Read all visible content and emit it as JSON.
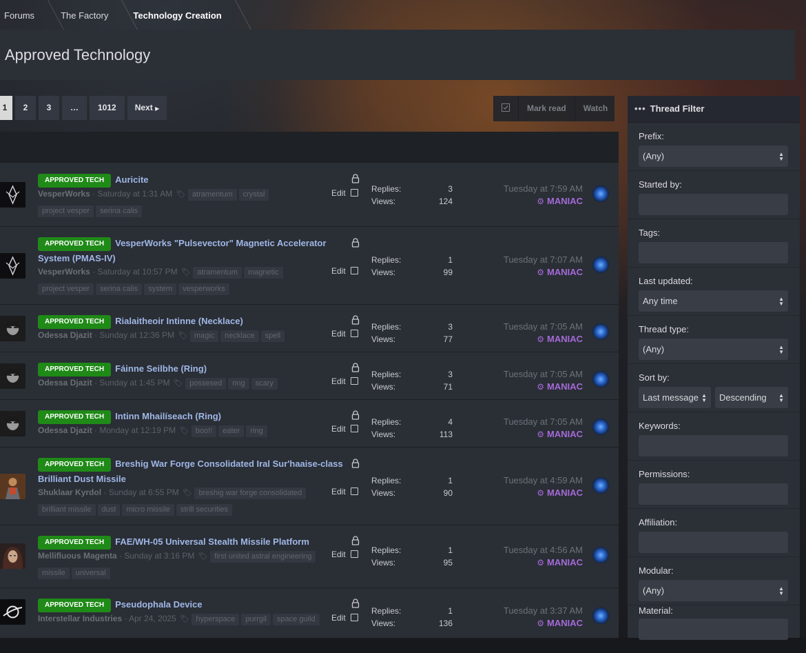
{
  "breadcrumb": [
    "Forums",
    "The Factory",
    "Technology Creation"
  ],
  "page_title": "Approved Technology",
  "pagination": {
    "pages": [
      "1",
      "2",
      "3",
      "…",
      "1012"
    ],
    "current": "1",
    "next": "Next"
  },
  "toolbar": {
    "mark_read": "Mark read",
    "watch": "Watch"
  },
  "threads": [
    {
      "prefix": "APPROVED TECH",
      "title": "Auricite",
      "author": "VesperWorks",
      "date": "Saturday at 1:31 AM",
      "tags1": [
        "atramentum",
        "crystal"
      ],
      "tags2": [
        "project vesper",
        "serina calis"
      ],
      "edit": "Edit",
      "replies_label": "Replies:",
      "views_label": "Views:",
      "replies": "3",
      "views": "124",
      "last_time": "Tuesday at 7:59 AM",
      "last_user": "MANIAC"
    },
    {
      "prefix": "APPROVED TECH",
      "title": "VesperWorks \"Pulsevector\" Magnetic Accelerator System (PMAS-IV)",
      "author": "VesperWorks",
      "date": "Saturday at 10:57 PM",
      "tags1": [
        "atramentum",
        "magnetic"
      ],
      "tags2": [
        "project vesper",
        "serina calis",
        "system",
        "vesperworks"
      ],
      "edit": "Edit",
      "replies_label": "Replies:",
      "views_label": "Views:",
      "replies": "1",
      "views": "99",
      "last_time": "Tuesday at 7:07 AM",
      "last_user": "MANIAC"
    },
    {
      "prefix": "APPROVED TECH",
      "title": "Rialaitheoir Intinne (Necklace)",
      "author": "Odessa Djazit",
      "date": "Sunday at 12:36 PM",
      "tags1": [
        "magic",
        "necklace",
        "spell"
      ],
      "tags2": [],
      "edit": "Edit",
      "replies_label": "Replies:",
      "views_label": "Views:",
      "replies": "3",
      "views": "77",
      "last_time": "Tuesday at 7:05 AM",
      "last_user": "MANIAC"
    },
    {
      "prefix": "APPROVED TECH",
      "title": "Fáinne Seilbhe (Ring)",
      "author": "Odessa Djazit",
      "date": "Sunday at 1:45 PM",
      "tags1": [
        "possesed",
        "ring",
        "scary"
      ],
      "tags2": [],
      "edit": "Edit",
      "replies_label": "Replies:",
      "views_label": "Views:",
      "replies": "3",
      "views": "71",
      "last_time": "Tuesday at 7:05 AM",
      "last_user": "MANIAC"
    },
    {
      "prefix": "APPROVED TECH",
      "title": "Intinn Mhailíseach (Ring)",
      "author": "Odessa Djazit",
      "date": "Monday at 12:19 PM",
      "tags1": [
        "boo!!",
        "eater",
        "ring"
      ],
      "tags2": [],
      "edit": "Edit",
      "replies_label": "Replies:",
      "views_label": "Views:",
      "replies": "4",
      "views": "113",
      "last_time": "Tuesday at 7:05 AM",
      "last_user": "MANIAC"
    },
    {
      "prefix": "APPROVED TECH",
      "title": "Breshig War Forge Consolidated Iral Sur'haaise-class Brilliant Dust Missile",
      "author": "Shuklaar Kyrdol",
      "date": "Sunday at 6:55 PM",
      "tags1": [
        "breshig war forge consolidated"
      ],
      "tags2": [
        "brilliant missile",
        "dust",
        "micro missile",
        "strill securities"
      ],
      "edit": "Edit",
      "replies_label": "Replies:",
      "views_label": "Views:",
      "replies": "1",
      "views": "90",
      "last_time": "Tuesday at 4:59 AM",
      "last_user": "MANIAC"
    },
    {
      "prefix": "APPROVED TECH",
      "title": "FAE/WH-05 Universal Stealth Missile Platform",
      "author": "Mellifluous Magenta",
      "date": "Sunday at 3:16 PM",
      "tags1": [
        "first united astral engineering"
      ],
      "tags2": [
        "missile",
        "universal"
      ],
      "edit": "Edit",
      "replies_label": "Replies:",
      "views_label": "Views:",
      "replies": "1",
      "views": "95",
      "last_time": "Tuesday at 4:56 AM",
      "last_user": "MANIAC"
    },
    {
      "prefix": "APPROVED TECH",
      "title": "Pseudophala Device",
      "author": "Interstellar Industries",
      "date": "Apr 24, 2025",
      "tags1": [
        "hyperspace",
        "purrgil",
        "space guild"
      ],
      "tags2": [],
      "edit": "Edit",
      "replies_label": "Replies:",
      "views_label": "Views:",
      "replies": "1",
      "views": "136",
      "last_time": "Tuesday at 3:37 AM",
      "last_user": "MANIAC"
    }
  ],
  "filter": {
    "title": "Thread Filter",
    "prefix_label": "Prefix:",
    "prefix_value": "(Any)",
    "started_by_label": "Started by:",
    "tags_label": "Tags:",
    "last_updated_label": "Last updated:",
    "last_updated_value": "Any time",
    "thread_type_label": "Thread type:",
    "thread_type_value": "(Any)",
    "sort_by_label": "Sort by:",
    "sort_by_value": "Last message",
    "sort_dir_value": "Descending",
    "keywords_label": "Keywords:",
    "permissions_label": "Permissions:",
    "affiliation_label": "Affiliation:",
    "modular_label": "Modular:",
    "modular_value": "(Any)",
    "material_label": "Material:"
  },
  "colors": {
    "prefix_green": "#1f8a17",
    "link_blue": "#9fb7e6",
    "user_purple": "#a46ad8"
  }
}
